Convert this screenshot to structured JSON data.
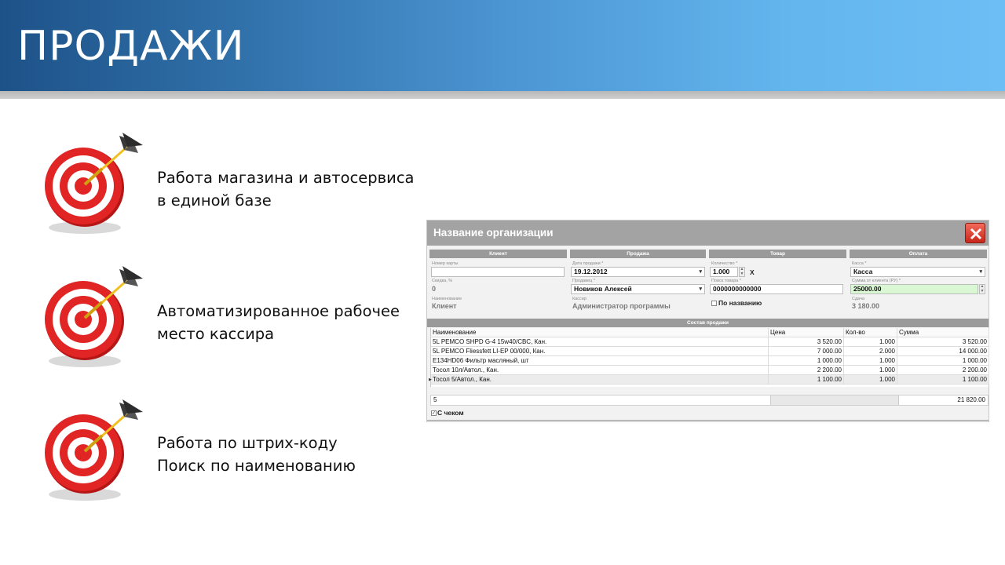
{
  "slide": {
    "title": "ПРОДАЖИ",
    "features": [
      {
        "line1": "Работа магазина и автосервиса",
        "line2": "в единой базе"
      },
      {
        "line1": "Автоматизированное рабочее",
        "line2": "место кассира"
      },
      {
        "line1": "Работа по штрих-коду",
        "line2": "Поиск по наименованию"
      }
    ]
  },
  "window": {
    "title": "Название организации",
    "sections": {
      "client": "Клиент",
      "sale": "Продажа",
      "product": "Товар",
      "payment": "Оплата"
    },
    "client": {
      "card_label": "Номер карты",
      "card_value": "",
      "discount_label": "Скидка, %",
      "discount_value": "0",
      "name_label": "Наименование",
      "name_value": "Клиент"
    },
    "sale": {
      "date_label": "Дата продажи *",
      "date_value": "19.12.2012",
      "seller_label": "Продавец *",
      "seller_value": "Новиков Алексей",
      "cashier_label": "Кассир",
      "cashier_value": "Администратор программы"
    },
    "product": {
      "qty_label": "Количество *",
      "qty_value": "1.000",
      "multiply": "X",
      "search_label": "Поиск товара *",
      "search_value": "0000000000000",
      "by_name_label": "По названию",
      "by_name_checked": false
    },
    "payment": {
      "cash_label": "Касса *",
      "cash_value": "Касса",
      "amount_label": "Сумма от клиента (РУ) *",
      "amount_value": "25000.00",
      "change_label": "Сдача",
      "change_value": "3 180.00"
    },
    "sale_items_title": "Состав продажи",
    "columns": [
      "Наименование",
      "Цена",
      "Кол-во",
      "Сумма"
    ],
    "rows": [
      {
        "name": "5L PEMCO SHPD G-4 15w40/CBC, Кан.",
        "price": "3 520.00",
        "qty": "1.000",
        "sum": "3 520.00"
      },
      {
        "name": "5L PEMCO Fliessfett LI-EP 00/000, Кан.",
        "price": "7 000.00",
        "qty": "2.000",
        "sum": "14 000.00"
      },
      {
        "name": "E134HD06 Фильтр масляный, шт",
        "price": "1 000.00",
        "qty": "1.000",
        "sum": "1 000.00"
      },
      {
        "name": "Тосол 10л/Автол., Кан.",
        "price": "2 200.00",
        "qty": "1.000",
        "sum": "2 200.00"
      },
      {
        "name": "Тосол 5/Автол., Кан.",
        "price": "1 100.00",
        "qty": "1.000",
        "sum": "1 100.00"
      }
    ],
    "footer_count": "5",
    "footer_total": "21 820.00",
    "receipt_label": "С чеком",
    "receipt_checked": true
  },
  "icons": {
    "target": "dart-target-icon",
    "close": "close-icon"
  },
  "colors": {
    "header_dark": "#1d5288",
    "header_light": "#6dbef5",
    "target_red": "#d81e1e",
    "titlebar": "#a3a3a3"
  }
}
